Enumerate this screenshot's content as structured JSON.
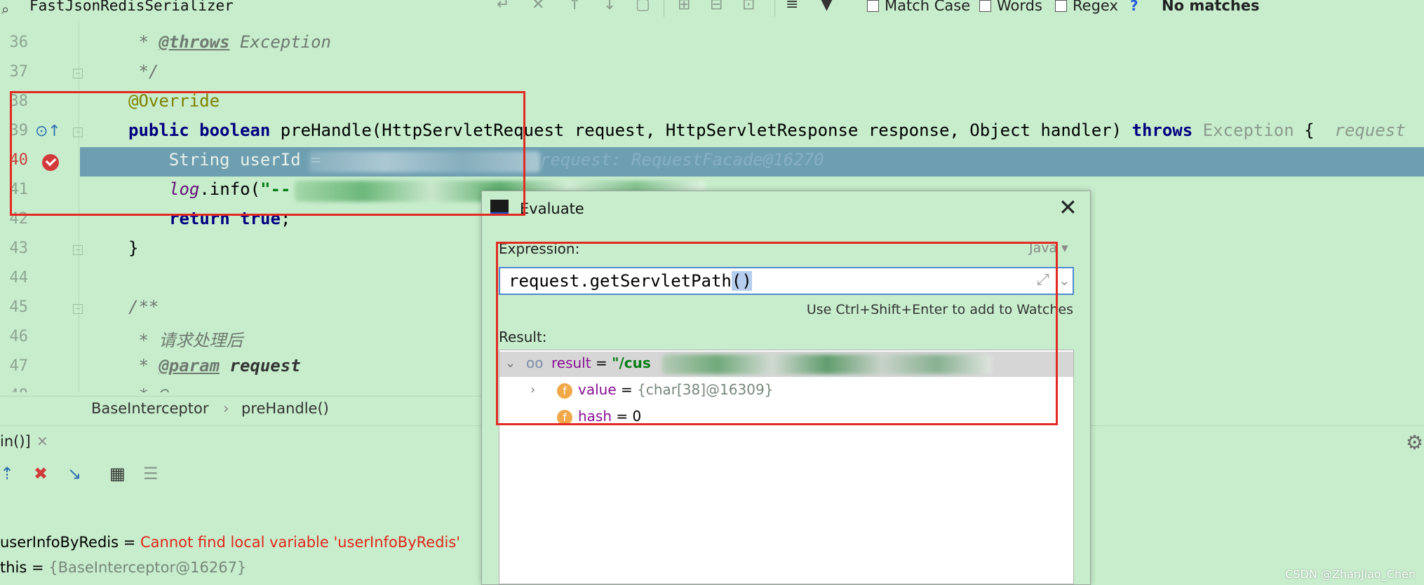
{
  "search": {
    "query": "FastJsonRedisSerializer",
    "match_case_label": "Match Case",
    "words_label": "Words",
    "regex_label": "Regex",
    "help": "?",
    "status": "No matches"
  },
  "editor": {
    "lines": [
      {
        "num": "36",
        "pre": " * ",
        "tag": "@throws",
        "post": " Exception"
      },
      {
        "num": "37",
        "text": " */"
      },
      {
        "num": "38",
        "annotation": "@Override"
      },
      {
        "num": "39",
        "kw1": "public",
        "kw2": "boolean",
        "sig": " preHandle(HttpServletRequest request, HttpServletResponse response, Object handler) ",
        "kw3": "throws",
        "exc": " Exception",
        "brace": " {",
        "hint": "request"
      },
      {
        "num": "40",
        "code": "    String userId = ",
        "hint": "request: RequestFacade@16270"
      },
      {
        "num": "41",
        "field": "log",
        "call": ".info(",
        "str": "\"--"
      },
      {
        "num": "42",
        "kw": "return",
        "kw2": "true",
        "end": ";"
      },
      {
        "num": "43",
        "text": "}"
      },
      {
        "num": "44",
        "text": ""
      },
      {
        "num": "45",
        "text": "/**"
      },
      {
        "num": "46",
        "text": " * 请求处理后"
      },
      {
        "num": "47",
        "pre": " * ",
        "tag": "@param",
        "post": " request"
      },
      {
        "num": "48",
        "text": " * @"
      }
    ]
  },
  "breadcrumb": {
    "class": "BaseInterceptor",
    "sep": "›",
    "method": "preHandle()"
  },
  "debug": {
    "tab_label": "in()]",
    "tab_close": "×",
    "variables": [
      {
        "name": "userInfoByRedis",
        "eq": " = ",
        "value": "Cannot find local variable 'userInfoByRedis'"
      },
      {
        "name": "this",
        "eq": " = ",
        "value": "{BaseInterceptor@16267}"
      }
    ]
  },
  "evaluate": {
    "title": "Evaluate",
    "close": "✕",
    "expression_label": "Expression:",
    "language": "Java ▾",
    "expression": "request.getServletPath",
    "expression_sel": "()",
    "hint": "Use Ctrl+Shift+Enter to add to Watches",
    "result_label": "Result:",
    "tree": {
      "root_name": "result",
      "root_eq": " = ",
      "root_value": "\"/cus",
      "child1_name": "value",
      "child1_eq": " = ",
      "child1_value": "{char[38]@16309}",
      "child2_name": "hash",
      "child2_eq": " = ",
      "child2_value": "0"
    }
  },
  "watermark": "CSDN @ZhanJiao_Chen",
  "colors": {
    "background": "#c7edcc",
    "execution_line": "#6e9fb1",
    "highlight_box": "#e32a22",
    "keyword": "#000080",
    "error": "#e0261b"
  }
}
